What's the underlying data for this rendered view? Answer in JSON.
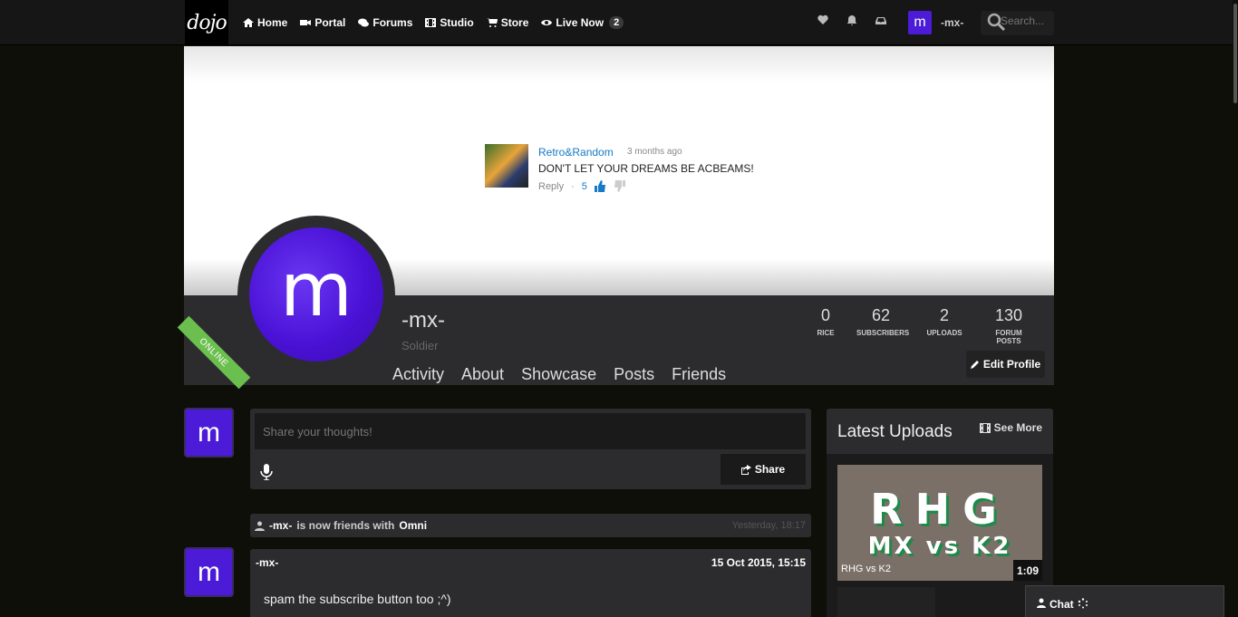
{
  "nav": {
    "logo": "dojo",
    "items": [
      {
        "label": "Home",
        "icon": "home-icon"
      },
      {
        "label": "Portal",
        "icon": "video-camera-icon"
      },
      {
        "label": "Forums",
        "icon": "comments-icon"
      },
      {
        "label": "Studio",
        "icon": "film-icon"
      },
      {
        "label": "Store",
        "icon": "cart-icon"
      },
      {
        "label": "Live Now",
        "icon": "eye-icon",
        "badge": "2"
      }
    ],
    "username": "-mx-",
    "avatar_letter": "m",
    "search_placeholder": "Search..."
  },
  "banner_comment": {
    "author": "Retro&Random",
    "time": "3 months ago",
    "text": "DON'T LET YOUR DREAMS BE ACBEAMS!",
    "reply": "Reply",
    "dot": "·",
    "likes": "5"
  },
  "profile": {
    "avatar_letter": "m",
    "status": "ONLINE",
    "name": "-mx-",
    "rank": "Soldier",
    "tabs": [
      "Activity",
      "About",
      "Showcase",
      "Posts",
      "Friends"
    ],
    "stats": [
      {
        "value": "0",
        "label": "RICE"
      },
      {
        "value": "62",
        "label": "SUBSCRIBERS"
      },
      {
        "value": "2",
        "label": "UPLOADS"
      },
      {
        "value": "130",
        "label": "FORUM POSTS"
      }
    ],
    "edit_label": "Edit Profile"
  },
  "composer": {
    "placeholder": "Share your thoughts!",
    "share_label": "Share"
  },
  "activity": {
    "actor": "-mx-",
    "text": "is now friends with",
    "target": "Omni",
    "when": "Yesterday, 18:17"
  },
  "post": {
    "author": "-mx-",
    "date": "15 Oct 2015, 15:15",
    "body": "spam the subscribe button too ;^)"
  },
  "sidebar": {
    "title": "Latest Uploads",
    "see_more": "See More",
    "upload": {
      "thumb_line1": "RHG",
      "thumb_line2": "MX vs K2",
      "caption": "RHG vs K2",
      "duration": "1:09"
    }
  },
  "chat": {
    "label": "Chat"
  },
  "colors": {
    "accent_purple": "#4b1bd8",
    "online_green": "#6bbf4e",
    "link_blue": "#167ac6",
    "panel": "#2c2c2f",
    "page_bg": "#0e0f08"
  }
}
